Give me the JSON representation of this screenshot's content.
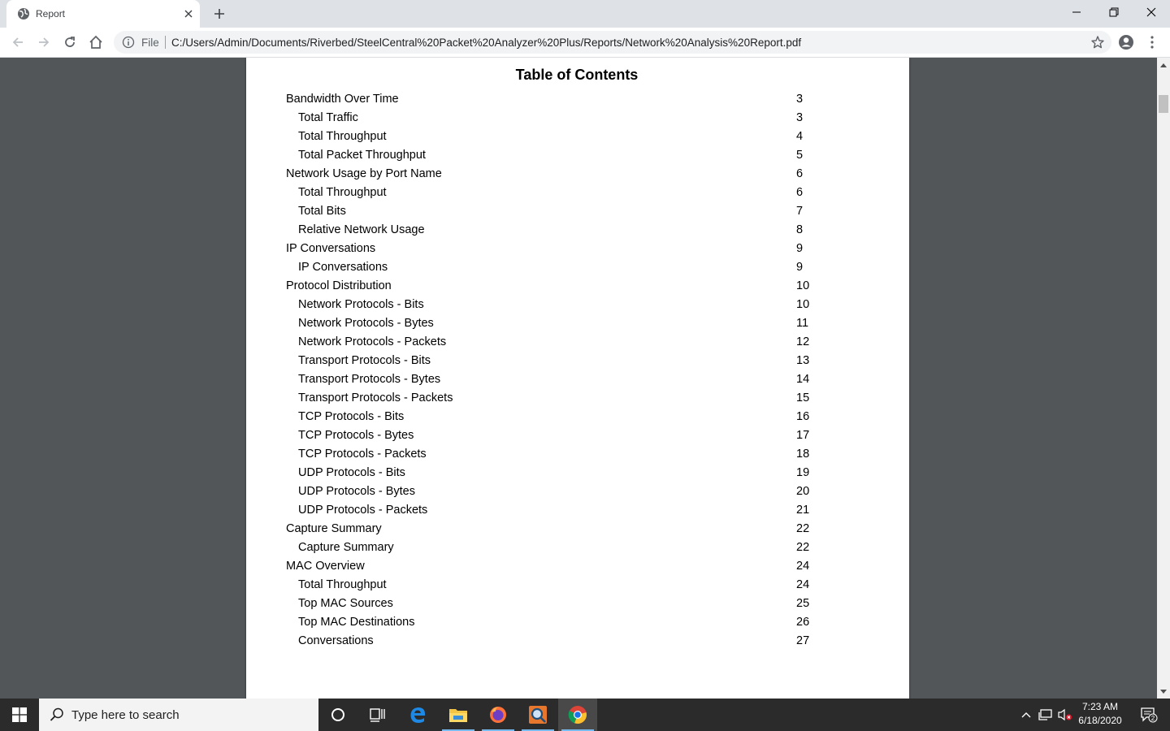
{
  "browser": {
    "tab_title": "Report",
    "address_scheme_label": "File",
    "address_url": "C:/Users/Admin/Documents/Riverbed/SteelCentral%20Packet%20Analyzer%20Plus/Reports/Network%20Analysis%20Report.pdf"
  },
  "document": {
    "title": "Table of Contents",
    "entries": [
      {
        "label": "Bandwidth Over Time",
        "page": "3",
        "level": 1
      },
      {
        "label": "Total Traffic",
        "page": "3",
        "level": 2
      },
      {
        "label": "Total Throughput",
        "page": "4",
        "level": 2
      },
      {
        "label": "Total Packet Throughput",
        "page": "5",
        "level": 2
      },
      {
        "label": "Network Usage by Port Name",
        "page": "6",
        "level": 1
      },
      {
        "label": "Total Throughput",
        "page": "6",
        "level": 2
      },
      {
        "label": "Total Bits",
        "page": "7",
        "level": 2
      },
      {
        "label": "Relative Network Usage",
        "page": "8",
        "level": 2
      },
      {
        "label": "IP Conversations",
        "page": "9",
        "level": 1
      },
      {
        "label": "IP Conversations",
        "page": "9",
        "level": 2
      },
      {
        "label": "Protocol Distribution",
        "page": "10",
        "level": 1
      },
      {
        "label": "Network Protocols - Bits",
        "page": "10",
        "level": 2
      },
      {
        "label": "Network Protocols - Bytes",
        "page": "11",
        "level": 2
      },
      {
        "label": "Network Protocols - Packets",
        "page": "12",
        "level": 2
      },
      {
        "label": "Transport Protocols - Bits",
        "page": "13",
        "level": 2
      },
      {
        "label": "Transport Protocols - Bytes",
        "page": "14",
        "level": 2
      },
      {
        "label": "Transport Protocols - Packets",
        "page": "15",
        "level": 2
      },
      {
        "label": "TCP Protocols - Bits",
        "page": "16",
        "level": 2
      },
      {
        "label": "TCP Protocols - Bytes",
        "page": "17",
        "level": 2
      },
      {
        "label": "TCP Protocols - Packets",
        "page": "18",
        "level": 2
      },
      {
        "label": "UDP Protocols - Bits",
        "page": "19",
        "level": 2
      },
      {
        "label": "UDP Protocols - Bytes",
        "page": "20",
        "level": 2
      },
      {
        "label": "UDP Protocols - Packets",
        "page": "21",
        "level": 2
      },
      {
        "label": "Capture Summary",
        "page": "22",
        "level": 1
      },
      {
        "label": "Capture Summary",
        "page": "22",
        "level": 2
      },
      {
        "label": "MAC Overview",
        "page": "24",
        "level": 1
      },
      {
        "label": "Total Throughput",
        "page": "24",
        "level": 2
      },
      {
        "label": "Top MAC Sources",
        "page": "25",
        "level": 2
      },
      {
        "label": "Top MAC Destinations",
        "page": "26",
        "level": 2
      },
      {
        "label": "Conversations",
        "page": "27",
        "level": 2
      }
    ]
  },
  "taskbar": {
    "search_placeholder": "Type here to search",
    "time": "7:23 AM",
    "date": "6/18/2020",
    "notification_count": "2"
  },
  "colors": {
    "viewer_background": "#525659",
    "tab_strip": "#dee1e6",
    "taskbar": "#2b2b2b",
    "chrome_blue": "#1a73e8"
  }
}
